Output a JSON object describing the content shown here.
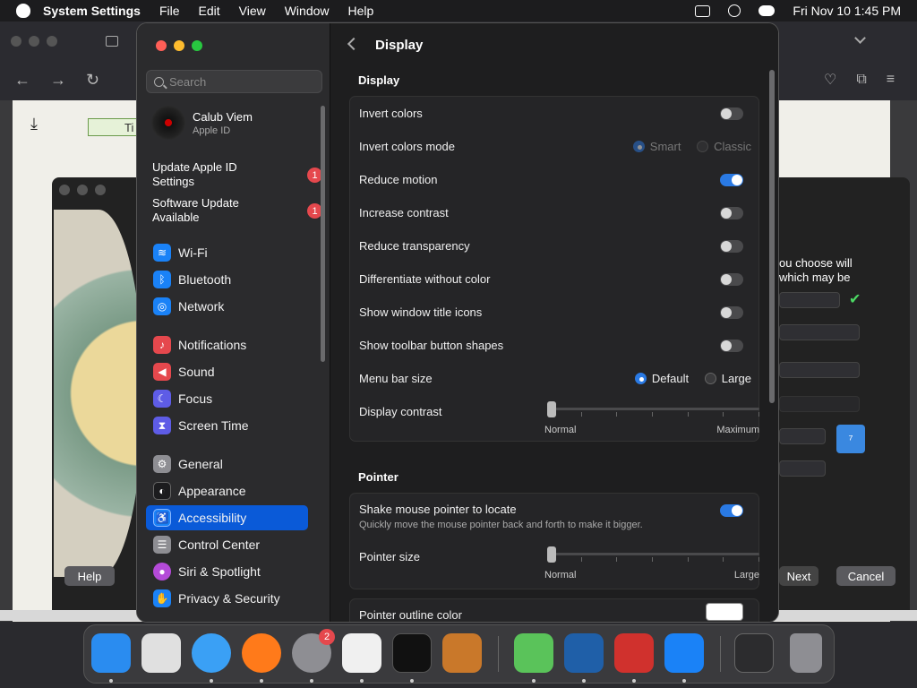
{
  "menubar": {
    "app": "System Settings",
    "items": [
      "File",
      "Edit",
      "View",
      "Window",
      "Help"
    ],
    "clock": "Fri Nov 10  1:45 PM"
  },
  "background_dialog": {
    "text_line1": "ou choose will",
    "text_line2": "which may be",
    "help": "Help",
    "next": "Next",
    "cancel": "Cancel",
    "partial_tab": "Ti"
  },
  "sidebar": {
    "search_placeholder": "Search",
    "user_name": "Calub Viem",
    "user_sub": "Apple ID",
    "notices": [
      {
        "label": "Update Apple ID Settings",
        "badge": "1"
      },
      {
        "label": "Software Update Available",
        "badge": "1"
      }
    ],
    "items": [
      {
        "label": "Wi-Fi",
        "icon": "wifi-icon",
        "color": "#1a82f7"
      },
      {
        "label": "Bluetooth",
        "icon": "bluetooth-icon",
        "color": "#1a82f7"
      },
      {
        "label": "Network",
        "icon": "globe-icon",
        "color": "#1a82f7"
      },
      {
        "label": "Notifications",
        "icon": "bell-icon",
        "color": "#e5484d"
      },
      {
        "label": "Sound",
        "icon": "speaker-icon",
        "color": "#e5484d"
      },
      {
        "label": "Focus",
        "icon": "moon-icon",
        "color": "#5e5ce6"
      },
      {
        "label": "Screen Time",
        "icon": "hourglass-icon",
        "color": "#5e5ce6"
      },
      {
        "label": "General",
        "icon": "gear-icon",
        "color": "#8e8e93"
      },
      {
        "label": "Appearance",
        "icon": "appearance-icon",
        "color": "#1c1c1e"
      },
      {
        "label": "Accessibility",
        "icon": "accessibility-icon",
        "color": "#1a82f7"
      },
      {
        "label": "Control Center",
        "icon": "control-center-icon",
        "color": "#8e8e93"
      },
      {
        "label": "Siri & Spotlight",
        "icon": "siri-icon",
        "color": "#b44ad8"
      },
      {
        "label": "Privacy & Security",
        "icon": "hand-icon",
        "color": "#1a82f7"
      }
    ]
  },
  "main": {
    "title": "Display",
    "display_section": "Display",
    "rows": [
      {
        "label": "Invert colors",
        "toggle": false
      },
      {
        "label": "Invert colors mode",
        "options": [
          "Smart",
          "Classic"
        ],
        "selected": "Smart",
        "disabled": true
      },
      {
        "label": "Reduce motion",
        "toggle": true
      },
      {
        "label": "Increase contrast",
        "toggle": false
      },
      {
        "label": "Reduce transparency",
        "toggle": false
      },
      {
        "label": "Differentiate without color",
        "toggle": false
      },
      {
        "label": "Show window title icons",
        "toggle": false
      },
      {
        "label": "Show toolbar button shapes",
        "toggle": false
      },
      {
        "label": "Menu bar size",
        "options": [
          "Default",
          "Large"
        ],
        "selected": "Default"
      },
      {
        "label": "Display contrast",
        "slider_min": "Normal",
        "slider_max": "Maximum",
        "value": 0
      }
    ],
    "pointer_section": "Pointer",
    "pointer": {
      "shake_label": "Shake mouse pointer to locate",
      "shake_sub": "Quickly move the mouse pointer back and forth to make it bigger.",
      "shake_on": true,
      "size_label": "Pointer size",
      "size_min": "Normal",
      "size_max": "Large",
      "size_value": 0,
      "outline_label": "Pointer outline color",
      "outline_color": "#ffffff"
    }
  },
  "dock": {
    "apps": [
      {
        "name": "finder-icon",
        "color": "#2a8cf0"
      },
      {
        "name": "launchpad-icon",
        "color": "#e0e0e0"
      },
      {
        "name": "safari-icon",
        "color": "#3aa0f5"
      },
      {
        "name": "firefox-icon",
        "color": "#ff7a1a"
      },
      {
        "name": "system-settings-icon",
        "color": "#8e8e93",
        "badge": "2"
      },
      {
        "name": "textedit-icon",
        "color": "#f0f0f0"
      },
      {
        "name": "terminal-icon",
        "color": "#111111"
      },
      {
        "name": "garageband-icon",
        "color": "#c9782a"
      },
      {
        "name": "maps-icon",
        "color": "#5ac35a"
      },
      {
        "name": "virtualbox-icon",
        "color": "#1f5fa8"
      },
      {
        "name": "photo-booth-icon",
        "color": "#d0312d"
      },
      {
        "name": "app-store-icon",
        "color": "#1a82f7"
      },
      {
        "name": "window-preview-icon",
        "color": "#2c2c2e"
      },
      {
        "name": "trash-icon",
        "color": "#8e8e93"
      }
    ]
  }
}
